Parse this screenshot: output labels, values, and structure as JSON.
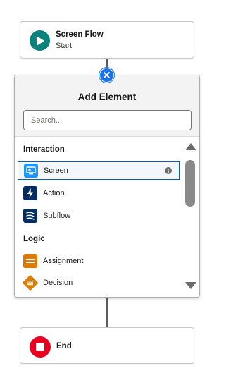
{
  "start_node": {
    "title": "Screen Flow",
    "subtitle": "Start",
    "icon": "play-icon",
    "color": "#0b827c"
  },
  "add_element_panel": {
    "title": "Add Element",
    "search_placeholder": "Search...",
    "search_value": "",
    "close_icon": "close-icon",
    "sections": [
      {
        "label": "Interaction",
        "items": [
          {
            "label": "Screen",
            "icon": "screen-icon",
            "color": "#1b96ff",
            "selected": true,
            "info": "i"
          },
          {
            "label": "Action",
            "icon": "lightning-icon",
            "color": "#032d60"
          },
          {
            "label": "Subflow",
            "icon": "subflow-icon",
            "color": "#032d60"
          }
        ]
      },
      {
        "label": "Logic",
        "items": [
          {
            "label": "Assignment",
            "icon": "assignment-icon",
            "color": "#dd7a01"
          },
          {
            "label": "Decision",
            "icon": "decision-icon",
            "color": "#dd7a01"
          }
        ]
      }
    ]
  },
  "end_node": {
    "title": "End",
    "icon": "stop-icon",
    "color": "#ea001e"
  }
}
